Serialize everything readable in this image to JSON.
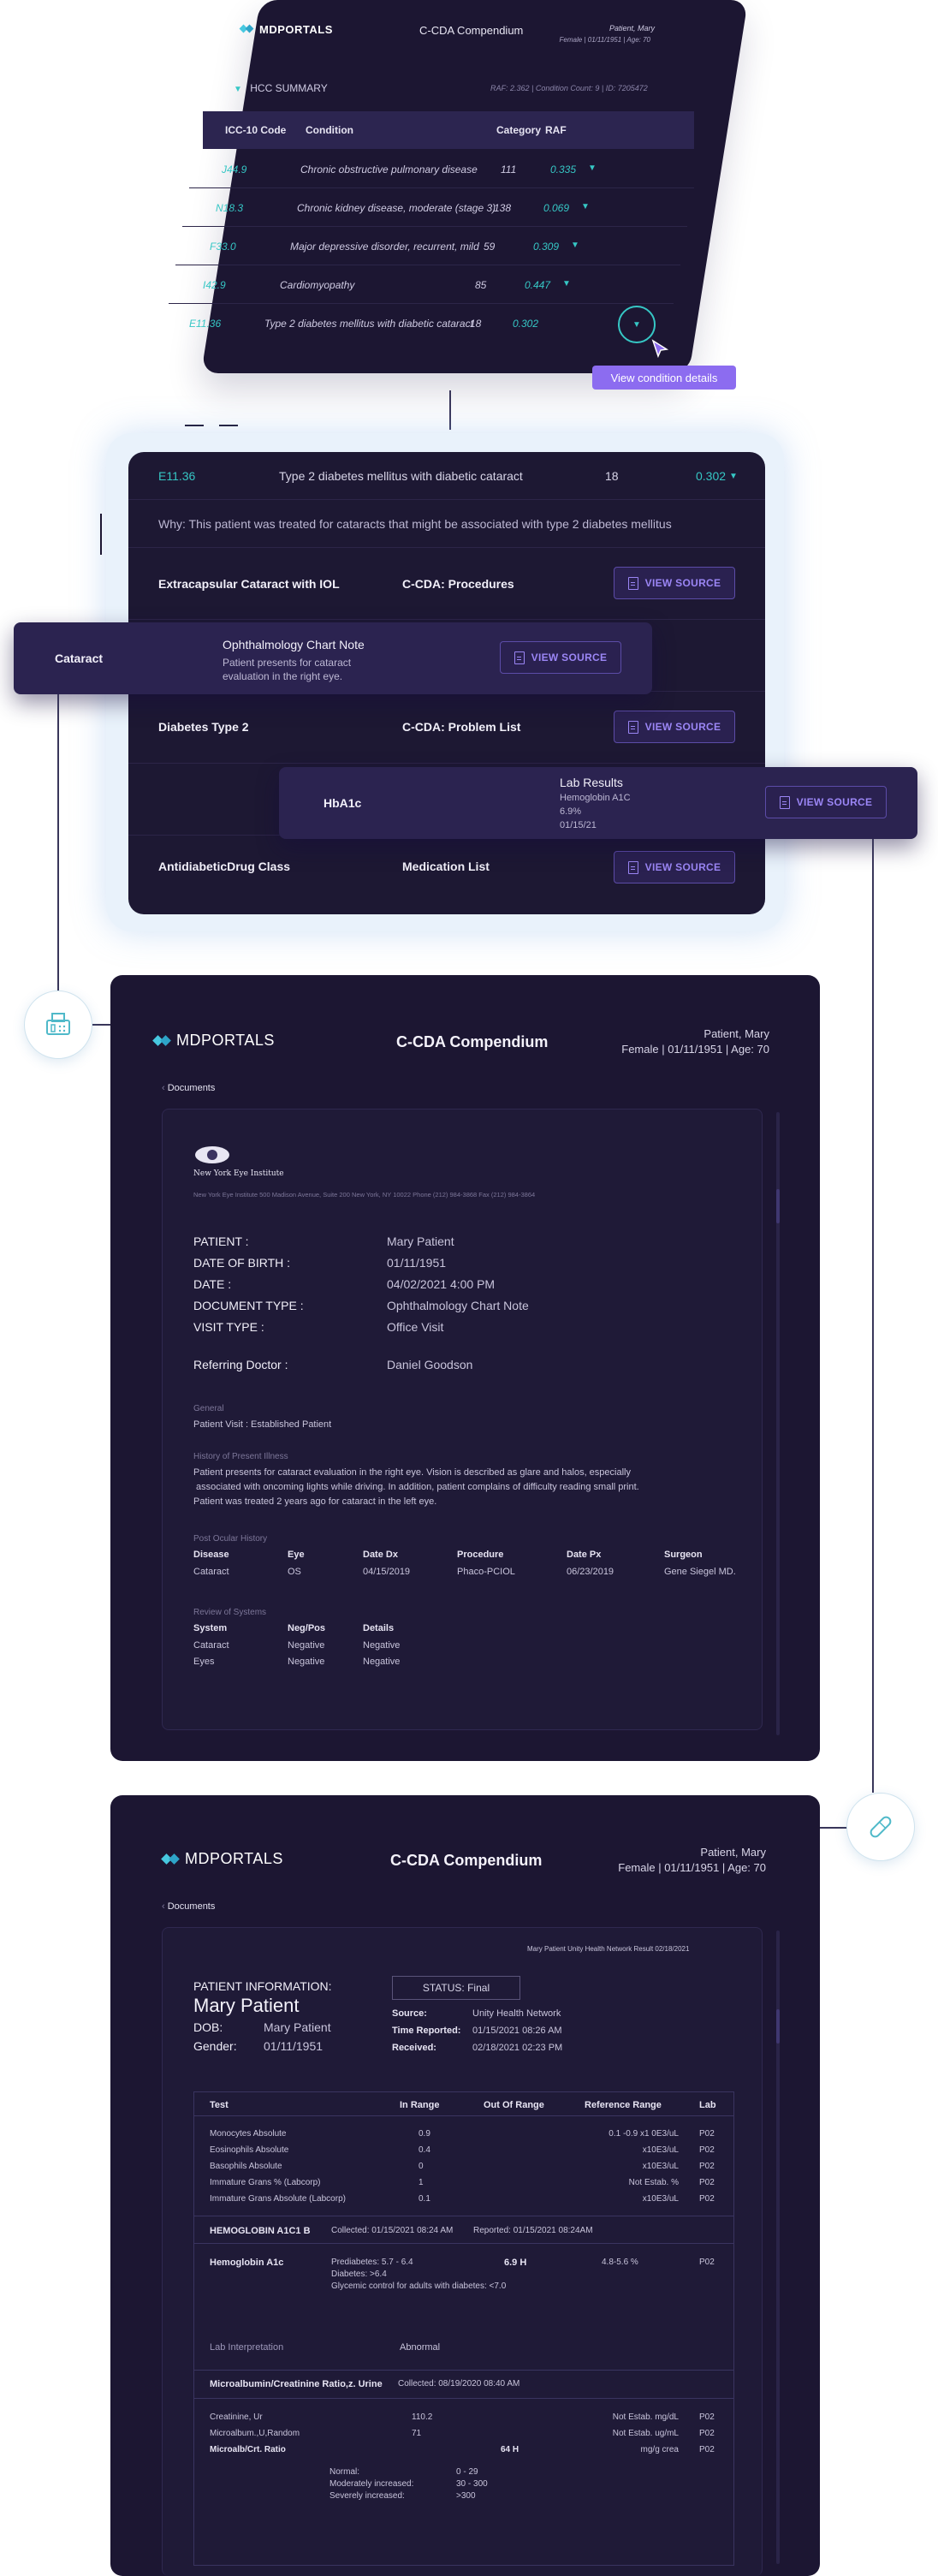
{
  "top": {
    "brand": "MDPORTALS",
    "title": "C-CDA Compendium",
    "patient_name": "Patient, Mary",
    "patient_meta": "Female | 01/11/1951 | Age: 70",
    "section": "HCC SUMMARY",
    "summary_meta": "RAF: 2.362 | Condition Count: 9 | ID: 7205472",
    "headers": {
      "code": "ICC-10 Code",
      "condition": "Condition",
      "category": "Category",
      "raf": "RAF"
    },
    "rows": [
      {
        "code": "J44.9",
        "condition": "Chronic obstructive pulmonary disease",
        "category": "111",
        "raf": "0.335"
      },
      {
        "code": "N18.3",
        "condition": "Chronic kidney disease, moderate (stage 3)",
        "category": "138",
        "raf": "0.069"
      },
      {
        "code": "F33.0",
        "condition": "Major depressive disorder, recurrent, mild",
        "category": "59",
        "raf": "0.309"
      },
      {
        "code": "I42.9",
        "condition": "Cardiomyopathy",
        "category": "85",
        "raf": "0.447"
      },
      {
        "code": "E11.36",
        "condition": "Type 2 diabetes mellitus with diabetic cataract",
        "category": "18",
        "raf": "0.302"
      }
    ],
    "tooltip": "View condition details"
  },
  "detail": {
    "row": {
      "code": "E11.36",
      "condition": "Type 2 diabetes mellitus with diabetic cataract",
      "category": "18",
      "raf": "0.302"
    },
    "why": "Why: This patient was treated for cataracts that might be associated with type 2 diabetes mellitus",
    "view_source": "VIEW SOURCE",
    "items": [
      {
        "name": "Extracapsular Cataract with IOL",
        "source": "C-CDA: Procedures"
      },
      {
        "name": "Diabetes Type 2",
        "source": "C-CDA: Problem List"
      },
      {
        "name": "AntidiabeticDrug Class",
        "source": "Medication List"
      }
    ],
    "pop1": {
      "name": "Cataract",
      "title": "Ophthalmology Chart Note",
      "text1": "Patient presents for cataract",
      "text2": "evaluation in the right eye."
    },
    "pop2": {
      "name": "HbA1c",
      "title": "Lab Results",
      "l1": "Hemoglobin A1C",
      "l2": "6.9%",
      "l3": "01/15/21"
    }
  },
  "doc1": {
    "brand": "MDPORTALS",
    "title": "C-CDA Compendium",
    "patient_name": "Patient, Mary",
    "patient_meta": "Female | 01/11/1951 | Age: 70",
    "back": "Documents",
    "institute": "New York Eye Institute",
    "address": "New York Eye Institute  500 Madison Avenue, Suite 200 New York, NY 10022  Phone (212) 984-3868  Fax (212) 984-3864",
    "fields": [
      {
        "label": "PATIENT :",
        "value": "Mary Patient"
      },
      {
        "label": "DATE OF BIRTH :",
        "value": "01/11/1951"
      },
      {
        "label": "DATE :",
        "value": "04/02/2021 4:00 PM"
      },
      {
        "label": "DOCUMENT TYPE :",
        "value": "Ophthalmology Chart Note"
      },
      {
        "label": "VISIT TYPE :",
        "value": "Office Visit"
      }
    ],
    "referring_label": "Referring Doctor :",
    "referring_value": "Daniel Goodson",
    "general_head": "General",
    "general_text": "Patient Visit : Established Patient",
    "hpi_head": "History of Present Illness",
    "hpi_l1": "Patient presents for cataract evaluation in the right eye. Vision is described as glare and halos, especially",
    "hpi_l2": " associated with oncoming lights while driving. In addition, patient complains of difficulty reading small print.",
    "hpi_l3": "Patient was treated 2 years ago for cataract in the left eye.",
    "pod_head": "Post Ocular History",
    "pod_cols": [
      "Disease",
      "Eye",
      "Date Dx",
      "Procedure",
      "Date Px",
      "Surgeon"
    ],
    "pod_row": [
      "Cataract",
      "OS",
      "04/15/2019",
      "Phaco-PCIOL",
      "06/23/2019",
      "Gene Siegel MD."
    ],
    "ros_head": "Review of Systems",
    "ros_cols": [
      "System",
      "Neg/Pos",
      "Details"
    ],
    "ros_rows": [
      [
        "Cataract",
        "Negative",
        "Negative"
      ],
      [
        "Eyes",
        "Negative",
        "Negative"
      ]
    ]
  },
  "doc2": {
    "brand": "MDPORTALS",
    "title": "C-CDA Compendium",
    "patient_name": "Patient, Mary",
    "patient_meta": "Female | 01/11/1951 | Age: 70",
    "back": "Documents",
    "result_line": "Mary Patient Unity Health Network Result 02/18/2021",
    "pi_label": "PATIENT INFORMATION:",
    "name": "Mary Patient",
    "dob_label": "DOB:",
    "dob_value": "Mary Patient",
    "gender_label": "Gender:",
    "gender_value": "01/11/1951",
    "status": "STATUS: Final",
    "source_label": "Source:",
    "source_value": "Unity Health Network",
    "time_label": "Time Reported:",
    "time_value": "01/15/2021 08:26 AM",
    "received_label": "Received:",
    "received_value": "02/18/2021 02:23 PM",
    "cols": [
      "Test",
      "In Range",
      "Out Of Range",
      "Reference Range",
      "Lab"
    ],
    "rows": [
      [
        "Monocytes Absolute",
        "0.9",
        "",
        "0.1 -0.9 x1 0E3/uL",
        "P02"
      ],
      [
        "Eosinophils Absolute",
        "0.4",
        "",
        "x10E3/uL",
        "P02"
      ],
      [
        "Basophils Absolute",
        "0",
        "",
        "x10E3/uL",
        "P02"
      ],
      [
        "Immature Grans % (Labcorp)",
        "1",
        "",
        "Not Estab. %",
        "P02"
      ],
      [
        "Immature Grans Absolute (Labcorp)",
        "0.1",
        "",
        "x10E3/uL",
        "P02"
      ]
    ],
    "hba1c_head": "HEMOGLOBIN A1C1 B",
    "hba1c_collected": "Collected: 01/15/2021 08:24 AM",
    "hba1c_reported": "Reported: 01/15/2021 08:24AM",
    "hba1c_test": "Hemoglobin A1c",
    "hba1c_note1": "Prediabetes: 5.7 - 6.4",
    "hba1c_note2": "Diabetes: >6.4",
    "hba1c_note3": "Glycemic control for adults with diabetes: <7.0",
    "hba1c_value": "6.9 H",
    "hba1c_range": "4.8-5.6 %",
    "hba1c_lab": "P02",
    "interp_label": "Lab Interpretation",
    "interp_value": "Abnormal",
    "micro_head": "Microalbumin/Creatinine Ratio,z. Urine",
    "micro_collected": "Collected: 08/19/2020 08:40 AM",
    "micro_rows": [
      [
        "Creatinine, Ur",
        "110.2",
        "",
        "Not Estab. mg/dL",
        "P02"
      ],
      [
        "Microalbum.,U,Random",
        "71",
        "",
        "Not Estab. ug/mL",
        "P02"
      ],
      [
        "Microalb/Crt. Ratio",
        "",
        "64 H",
        "mg/g crea",
        "P02"
      ]
    ],
    "norm": [
      [
        "Normal:",
        "0 - 29"
      ],
      [
        "Moderately increased:",
        "30 - 300"
      ],
      [
        "Severely increased:",
        ">300"
      ]
    ]
  }
}
